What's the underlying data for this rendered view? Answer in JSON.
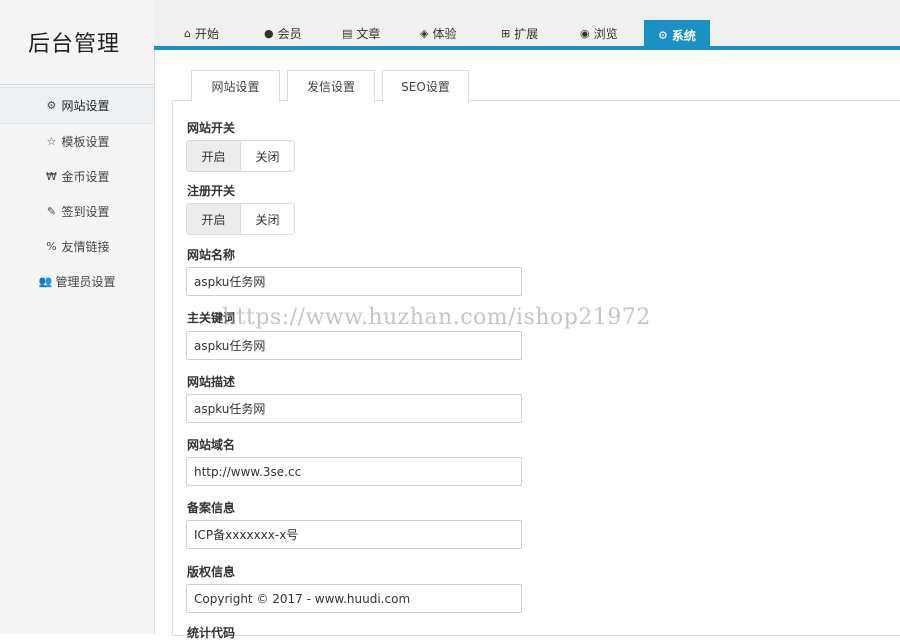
{
  "colors": {
    "accent": "#1b90c5",
    "sidebar_bg": "#f5f5f5"
  },
  "logo": {
    "text": "后台管理"
  },
  "sidebar": {
    "items": [
      {
        "label": "网站设置",
        "icon": "gear-icon",
        "glyph": "⚙"
      },
      {
        "label": "模板设置",
        "icon": "star-outline-icon",
        "glyph": "☆"
      },
      {
        "label": "金币设置",
        "icon": "won-sign-icon",
        "glyph": "₩"
      },
      {
        "label": "签到设置",
        "icon": "edit-icon",
        "glyph": "✎"
      },
      {
        "label": "友情链接",
        "icon": "link-icon",
        "glyph": "%"
      },
      {
        "label": "管理员设置",
        "icon": "users-icon",
        "glyph": "👥"
      }
    ]
  },
  "topnav": {
    "tabs": [
      {
        "label": "开始",
        "icon": "home-icon",
        "glyph": "⌂"
      },
      {
        "label": "会员",
        "icon": "user-icon",
        "glyph": "●"
      },
      {
        "label": "文章",
        "icon": "file-icon",
        "glyph": "▤"
      },
      {
        "label": "体验",
        "icon": "cube-icon",
        "glyph": "◈"
      },
      {
        "label": "扩展",
        "icon": "plus-square-icon",
        "glyph": "⊞"
      },
      {
        "label": "浏览",
        "icon": "eye-icon",
        "glyph": "◉"
      },
      {
        "label": "系统",
        "icon": "cogs-icon",
        "glyph": "⚙"
      }
    ]
  },
  "subtabs": [
    "网站设置",
    "发信设置",
    "SEO设置"
  ],
  "form": {
    "site_switch": {
      "label": "网站开关",
      "on": "开启",
      "off": "关闭"
    },
    "register_switch": {
      "label": "注册开关",
      "on": "开启",
      "off": "关闭"
    },
    "site_name": {
      "label": "网站名称",
      "value": "aspku任务网"
    },
    "keywords": {
      "label": "主关键词",
      "value": "aspku任务网"
    },
    "description": {
      "label": "网站描述",
      "value": "aspku任务网"
    },
    "domain": {
      "label": "网站域名",
      "value": "http://www.3se.cc"
    },
    "icp": {
      "label": "备案信息",
      "value": "ICP备xxxxxxx-x号"
    },
    "copyright": {
      "label": "版权信息",
      "value": "Copyright © 2017 - www.huudi.com"
    },
    "stats": {
      "label": "统计代码"
    }
  },
  "watermark": "https://www.huzhan.com/ishop21972"
}
